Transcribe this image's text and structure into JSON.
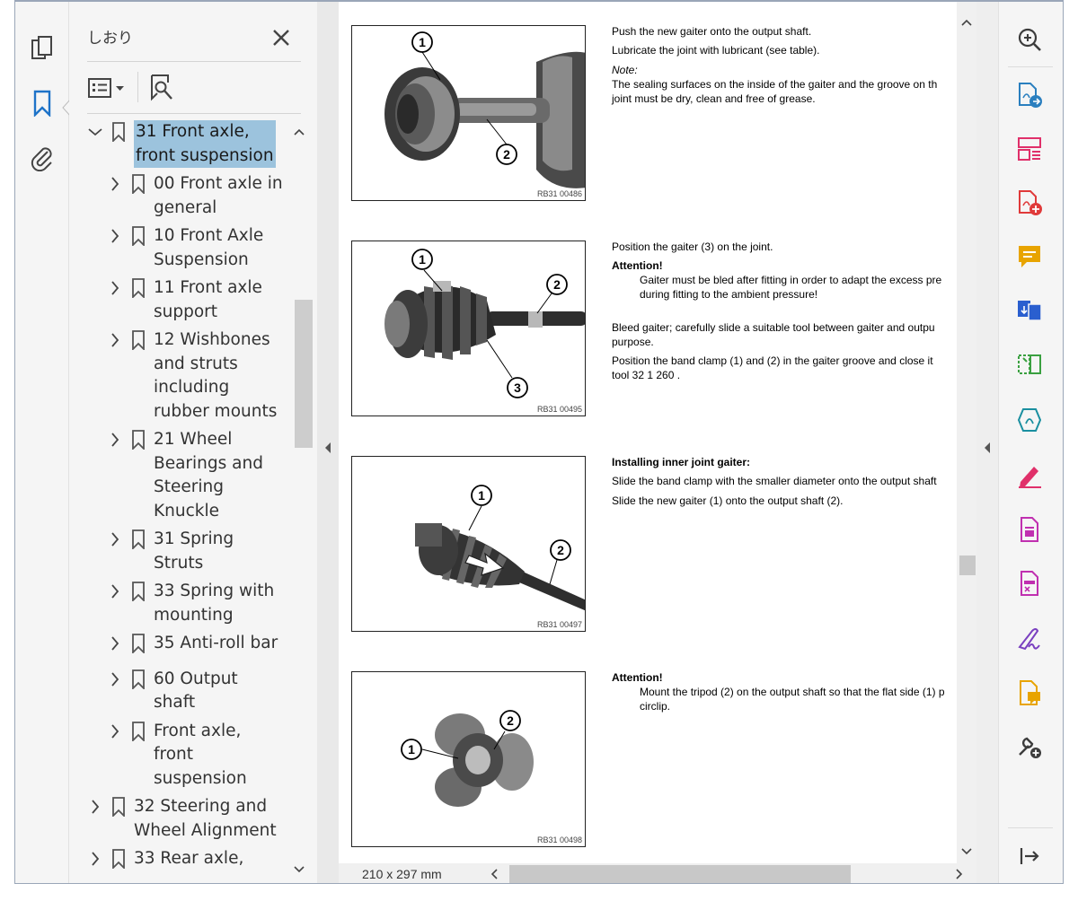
{
  "left_toolbar": {
    "items": [
      {
        "name": "pages-icon",
        "tooltip": ""
      },
      {
        "name": "bookmark-icon",
        "active": true
      },
      {
        "name": "attachment-icon"
      }
    ]
  },
  "bookmark_panel": {
    "title": "しおり",
    "items": [
      {
        "label": "31 Front axle, front suspension",
        "lines": [
          "31 Front axle,",
          "front suspension"
        ],
        "level": 1,
        "expanded": true,
        "selected": true
      },
      {
        "label": "00 Front axle in general",
        "lines": [
          "00 Front axle in",
          "general"
        ],
        "level": 2
      },
      {
        "label": "10 Front Axle Suspension",
        "lines": [
          "10 Front Axle",
          "Suspension"
        ],
        "level": 2
      },
      {
        "label": "11 Front axle support",
        "lines": [
          "11 Front axle",
          "support"
        ],
        "level": 2
      },
      {
        "label": "12 Wishbones and struts including rubber mounts",
        "lines": [
          "12 Wishbones",
          "and struts",
          "including",
          "rubber mounts"
        ],
        "level": 2
      },
      {
        "label": "21 Wheel Bearings and Steering Knuckle",
        "lines": [
          "21 Wheel",
          "Bearings and",
          "Steering",
          "Knuckle"
        ],
        "level": 2
      },
      {
        "label": "31 Spring Struts",
        "lines": [
          "31 Spring",
          "Struts"
        ],
        "level": 2
      },
      {
        "label": "33 Spring with mounting",
        "lines": [
          "33 Spring with",
          "mounting"
        ],
        "level": 2
      },
      {
        "label": "35 Anti-roll bar",
        "lines": [
          "35 Anti-roll bar"
        ],
        "level": 2
      },
      {
        "label": "60 Output shaft",
        "lines": [
          "60 Output",
          "shaft"
        ],
        "level": 2
      },
      {
        "label": "Front axle, front suspension",
        "lines": [
          "Front axle,",
          "front",
          "suspension"
        ],
        "level": 2
      },
      {
        "label": "32 Steering and Wheel Alignment",
        "lines": [
          "32 Steering and",
          "Wheel Alignment"
        ],
        "level": 1
      },
      {
        "label": "33 Rear axle,",
        "lines": [
          "33 Rear axle,"
        ],
        "level": 1
      }
    ]
  },
  "document": {
    "figures": [
      {
        "caption": "RB31 00486",
        "callouts": [
          "1",
          "2"
        ]
      },
      {
        "caption": "RB31 00495",
        "callouts": [
          "1",
          "2",
          "3"
        ]
      },
      {
        "caption": "RB31 00497",
        "callouts": [
          "1",
          "2"
        ]
      },
      {
        "caption": "RB31 00498",
        "callouts": [
          "1",
          "2"
        ]
      }
    ],
    "blocks": [
      {
        "lines": [
          {
            "text": "Push the new gaiter onto the output shaft.",
            "style": "normal"
          },
          {
            "text": "Lubricate the joint with lubricant (see table).",
            "style": "normal"
          },
          {
            "text": "Note:",
            "style": "italic"
          },
          {
            "text": "The sealing surfaces on the inside of the gaiter and the groove on th",
            "style": "normal"
          },
          {
            "text": "joint must be dry, clean and free of grease.",
            "style": "normal"
          }
        ]
      },
      {
        "lines": [
          {
            "text": "Position the gaiter (3) on the joint.",
            "style": "normal"
          },
          {
            "text": "Attention!",
            "style": "bold"
          },
          {
            "text": "Gaiter must be bled after fitting in order to adapt the excess pre",
            "style": "indent"
          },
          {
            "text": "during fitting to the ambient pressure!",
            "style": "indent"
          },
          {
            "text": "Bleed gaiter; carefully slide a suitable tool between gaiter and outpu",
            "style": "normal"
          },
          {
            "text": "purpose.",
            "style": "normal"
          },
          {
            "text": "Position the band clamp (1) and (2) in the gaiter groove and close it",
            "style": "normal"
          },
          {
            "text": "tool 32 1 260 .",
            "style": "normal"
          }
        ]
      },
      {
        "lines": [
          {
            "text": "Installing inner joint gaiter:",
            "style": "bold"
          },
          {
            "text": "Slide the band clamp with the smaller diameter onto the output shaft",
            "style": "normal"
          },
          {
            "text": "Slide the new gaiter (1) onto the output shaft (2).",
            "style": "normal"
          }
        ]
      },
      {
        "lines": [
          {
            "text": "Attention!",
            "style": "bold"
          },
          {
            "text": "Mount the tripod (2) on the output shaft so that the flat side (1) p",
            "style": "indent"
          },
          {
            "text": "circlip.",
            "style": "indent"
          }
        ]
      }
    ]
  },
  "status_bar": {
    "page_size": "210 x 297 mm"
  },
  "right_toolbar": {
    "items": [
      {
        "name": "zoom-icon",
        "color": "#3c3c3c"
      },
      {
        "name": "export-pdf-icon",
        "color": "#2a7fbf"
      },
      {
        "name": "organize-pages-icon",
        "color": "#e0306a"
      },
      {
        "name": "create-pdf-icon",
        "color": "#e03a3a"
      },
      {
        "name": "comment-icon",
        "color": "#e8a400"
      },
      {
        "name": "combine-files-icon",
        "color": "#2a5fcf"
      },
      {
        "name": "scan-ocr-icon",
        "color": "#3aa040"
      },
      {
        "name": "compress-pdf-icon",
        "color": "#1a8fa0"
      },
      {
        "name": "fill-sign-icon",
        "color": "#e0306a"
      },
      {
        "name": "protect-icon",
        "color": "#c030b0"
      },
      {
        "name": "redact-icon",
        "color": "#c030b0"
      },
      {
        "name": "request-signature-icon",
        "color": "#7a40c0"
      },
      {
        "name": "send-comment-icon",
        "color": "#e8a400"
      },
      {
        "name": "more-tools-icon",
        "color": "#3c3c3c"
      },
      {
        "name": "collapse-panel-icon",
        "color": "#3c3c3c"
      }
    ]
  }
}
